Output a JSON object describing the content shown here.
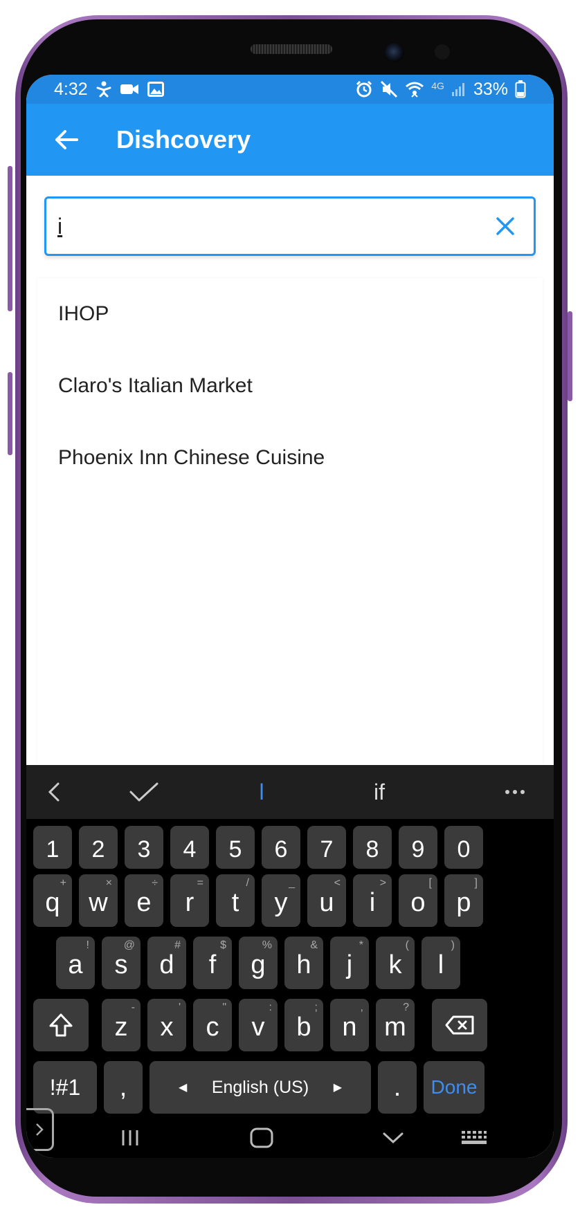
{
  "status_bar": {
    "time": "4:32",
    "battery": "33%",
    "network": "4G"
  },
  "app_bar": {
    "title": "Dishcovery"
  },
  "search": {
    "value": "i"
  },
  "results": [
    "IHOP",
    "Claro's Italian Market",
    "Phoenix Inn Chinese Cuisine"
  ],
  "keyboard": {
    "suggestions": [
      "l",
      "if"
    ],
    "number_row": [
      "1",
      "2",
      "3",
      "4",
      "5",
      "6",
      "7",
      "8",
      "9",
      "0"
    ],
    "row1": [
      {
        "k": "q",
        "h": "+"
      },
      {
        "k": "w",
        "h": "×"
      },
      {
        "k": "e",
        "h": "÷"
      },
      {
        "k": "r",
        "h": "="
      },
      {
        "k": "t",
        "h": "/"
      },
      {
        "k": "y",
        "h": "_"
      },
      {
        "k": "u",
        "h": "<"
      },
      {
        "k": "i",
        "h": ">"
      },
      {
        "k": "o",
        "h": "["
      },
      {
        "k": "p",
        "h": "]"
      }
    ],
    "row2": [
      {
        "k": "a",
        "h": "!"
      },
      {
        "k": "s",
        "h": "@"
      },
      {
        "k": "d",
        "h": "#"
      },
      {
        "k": "f",
        "h": "$"
      },
      {
        "k": "g",
        "h": "%"
      },
      {
        "k": "h",
        "h": "&"
      },
      {
        "k": "j",
        "h": "*"
      },
      {
        "k": "k",
        "h": "("
      },
      {
        "k": "l",
        "h": ")"
      }
    ],
    "row3": [
      {
        "k": "z",
        "h": "-"
      },
      {
        "k": "x",
        "h": "'"
      },
      {
        "k": "c",
        "h": "\""
      },
      {
        "k": "v",
        "h": ":"
      },
      {
        "k": "b",
        "h": ";"
      },
      {
        "k": "n",
        "h": ","
      },
      {
        "k": "m",
        "h": "?"
      }
    ],
    "symbols_label": "!#1",
    "comma": ",",
    "space_label": "English (US)",
    "period": ".",
    "done_label": "Done"
  },
  "colors": {
    "primary": "#2196f3",
    "status": "#2187e0",
    "accent_text": "#3d8ef0"
  }
}
